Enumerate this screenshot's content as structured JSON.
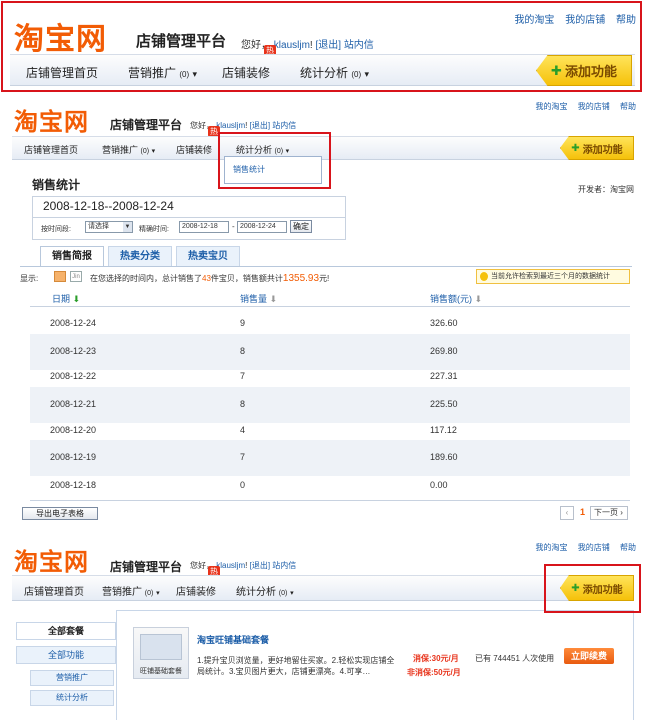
{
  "header": {
    "logo_text": "淘宝网",
    "platform_title": "店铺管理平台",
    "greeting_prefix": "您好，",
    "username": "klausljm",
    "greeting_suffix": "!",
    "logout": "[退出]",
    "inbox": "站内信",
    "top_links": [
      "我的淘宝",
      "我的店铺",
      "帮助"
    ]
  },
  "nav": {
    "items": [
      "店铺管理首页",
      "营销推广",
      "店铺装修",
      "统计分析"
    ],
    "marketing_count": "(0)",
    "stats_count": "(0)",
    "hot_badge": "热",
    "add_feature": "添加功能",
    "dropdown_arrow": "▾"
  },
  "dropdown": {
    "item": "销售统计"
  },
  "sales": {
    "title": "销售统计",
    "developer": "开发者：淘宝网",
    "date_range": "2008-12-18--2008-12-24",
    "period_label": "按时间段:",
    "period_select": "请选择",
    "precise_label": "精确时间:",
    "date_from": "2008-12-18",
    "date_sep": "-",
    "date_to": "2008-12-24",
    "confirm": "确定",
    "tabs": [
      "销售简报",
      "热卖分类",
      "热卖宝贝"
    ],
    "display_label": "显示:",
    "summary_pre": "在您选择的时间内，总计销售了",
    "summary_count": "43",
    "summary_mid": "件宝贝，销售额共计",
    "summary_amount": "1355.93",
    "summary_post": "元!",
    "notice": "当前允许检索到最近三个月的数据统计",
    "columns": [
      "日期",
      "销售量",
      "销售额(元)"
    ],
    "rows": [
      {
        "date": "2008-12-24",
        "qty": "9",
        "amount": "326.60"
      },
      {
        "date": "2008-12-23",
        "qty": "8",
        "amount": "269.80"
      },
      {
        "date": "2008-12-22",
        "qty": "7",
        "amount": "227.31"
      },
      {
        "date": "2008-12-21",
        "qty": "8",
        "amount": "225.50"
      },
      {
        "date": "2008-12-20",
        "qty": "4",
        "amount": "117.12"
      },
      {
        "date": "2008-12-19",
        "qty": "7",
        "amount": "189.60"
      },
      {
        "date": "2008-12-18",
        "qty": "0",
        "amount": "0.00"
      }
    ],
    "export": "导出电子表格",
    "current_page": "1",
    "next_page": "下一页"
  },
  "features": {
    "sidebar": [
      "全部套餐",
      "全部功能",
      "营销推广",
      "统计分析"
    ],
    "package_title": "淘宝旺铺基础套餐",
    "package_thumb_label": "旺铺基础套餐",
    "package_desc": "1.提升宝贝浏览量，更好地留住买家。2.轻松实现店铺全局统计。3.宝贝图片更大，店铺更漂亮。4.可享…",
    "price_promo": "消保:30元/月",
    "price_normal": "非消保:50元/月",
    "usage": "已有 744451 人次使用",
    "renew": "立即续费"
  },
  "colors": {
    "brand": "#f25c05",
    "link": "#1d5ea8",
    "highlight": "#d8141b"
  }
}
